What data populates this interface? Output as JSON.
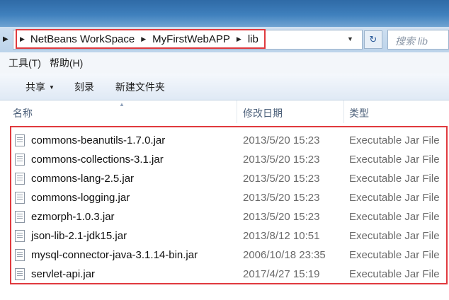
{
  "breadcrumbs": [
    "NetBeans WorkSpace",
    "MyFirstWebAPP",
    "lib"
  ],
  "search": {
    "placeholder": "搜索 lib"
  },
  "menu": [
    "工具(T)",
    "帮助(H)"
  ],
  "toolbar": {
    "share_label": "共享",
    "burn_label": "刻录",
    "new_folder_label": "新建文件夹"
  },
  "columns": {
    "name": "名称",
    "modified": "修改日期",
    "type": "类型"
  },
  "files": [
    {
      "name": "commons-beanutils-1.7.0.jar",
      "modified": "2013/5/20 15:23",
      "type": "Executable Jar File"
    },
    {
      "name": "commons-collections-3.1.jar",
      "modified": "2013/5/20 15:23",
      "type": "Executable Jar File"
    },
    {
      "name": "commons-lang-2.5.jar",
      "modified": "2013/5/20 15:23",
      "type": "Executable Jar File"
    },
    {
      "name": "commons-logging.jar",
      "modified": "2013/5/20 15:23",
      "type": "Executable Jar File"
    },
    {
      "name": "ezmorph-1.0.3.jar",
      "modified": "2013/5/20 15:23",
      "type": "Executable Jar File"
    },
    {
      "name": "json-lib-2.1-jdk15.jar",
      "modified": "2013/8/12 10:51",
      "type": "Executable Jar File"
    },
    {
      "name": "mysql-connector-java-3.1.14-bin.jar",
      "modified": "2006/10/18 23:35",
      "type": "Executable Jar File"
    },
    {
      "name": "servlet-api.jar",
      "modified": "2017/4/27 15:19",
      "type": "Executable Jar File"
    }
  ],
  "icons": {
    "file": "jar-file-icon",
    "refresh": "refresh-icon",
    "nav": "chevron-right-icon"
  },
  "colors": {
    "highlight": "#e03a3e",
    "toolbar": "#dfe9f5",
    "title_bar": "#3f80bd"
  }
}
